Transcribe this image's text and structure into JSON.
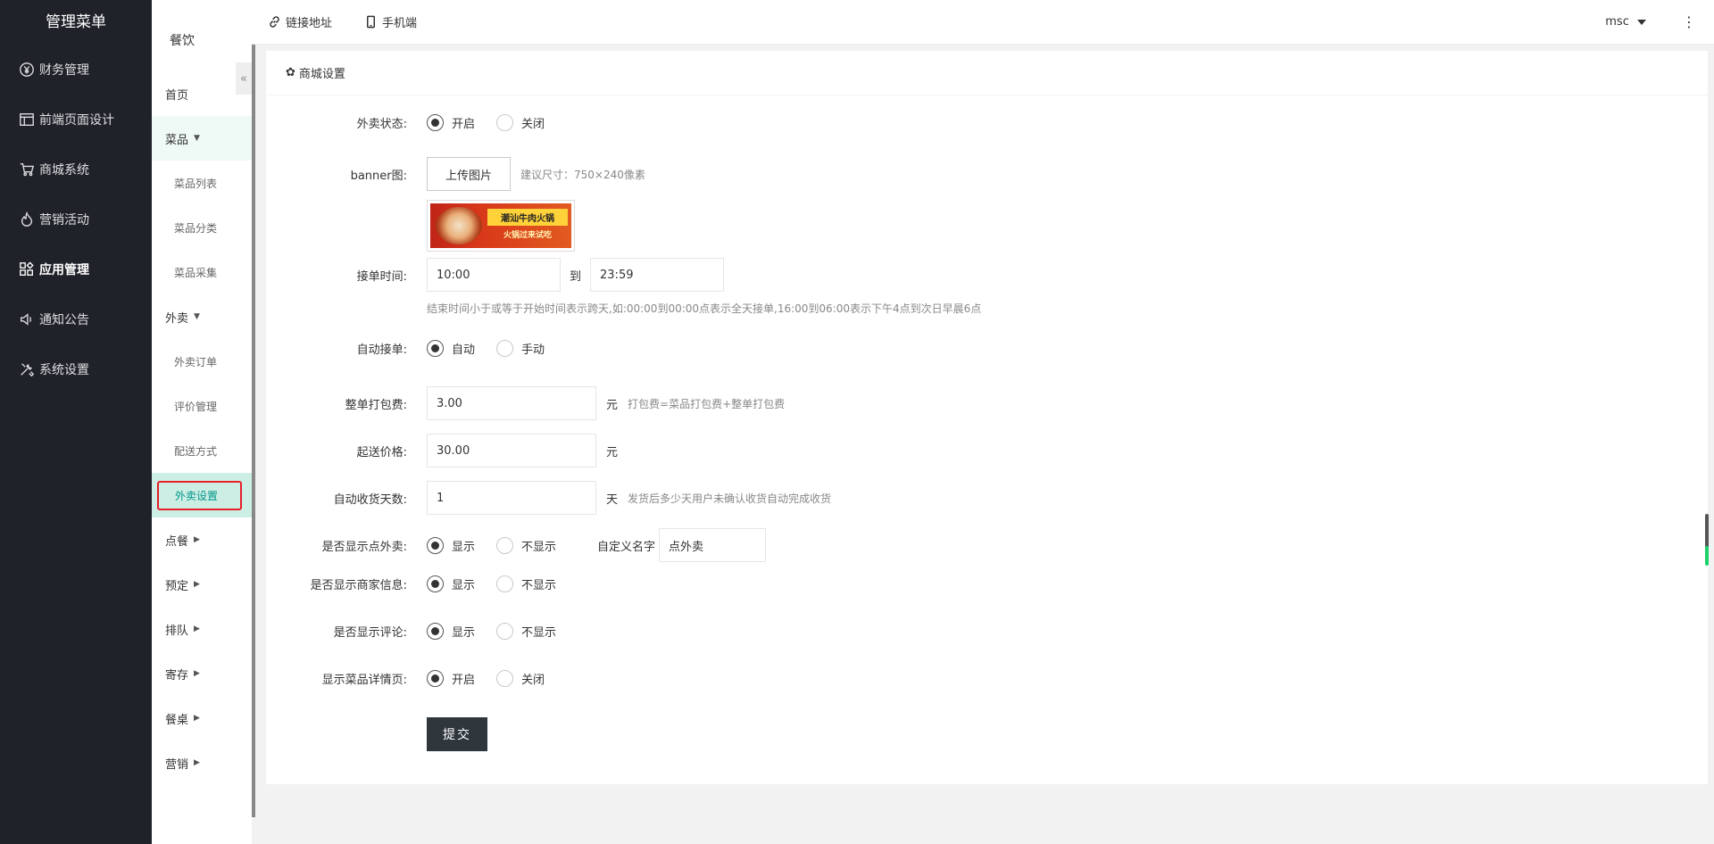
{
  "sidebar": {
    "title": "管理菜单",
    "items": [
      {
        "label": "财务管理",
        "icon": "yen-icon"
      },
      {
        "label": "前端页面设计",
        "icon": "layout-icon"
      },
      {
        "label": "商城系统",
        "icon": "cart-icon"
      },
      {
        "label": "营销活动",
        "icon": "fire-icon"
      },
      {
        "label": "应用管理",
        "icon": "apps-icon",
        "active": true
      },
      {
        "label": "通知公告",
        "icon": "speaker-icon"
      },
      {
        "label": "系统设置",
        "icon": "tools-icon"
      }
    ]
  },
  "subnav": {
    "title": "餐饮",
    "collapse": "«",
    "home": "首页",
    "dishes": {
      "label": "菜品",
      "items": [
        "菜品列表",
        "菜品分类",
        "菜品采集"
      ]
    },
    "takeout": {
      "label": "外卖",
      "items": [
        "外卖订单",
        "评价管理",
        "配送方式",
        "外卖设置"
      ]
    },
    "others": [
      "点餐",
      "预定",
      "排队",
      "寄存",
      "餐桌",
      "营销"
    ]
  },
  "topbar": {
    "link_label": "链接地址",
    "mobile_label": "手机端",
    "user": "msc",
    "more": "⋮"
  },
  "card": {
    "title": "商城设置",
    "fields": {
      "takeout_status": {
        "label": "外卖状态:",
        "options": [
          "开启",
          "关闭"
        ],
        "selected": 0
      },
      "banner": {
        "label": "banner图:",
        "button": "上传图片",
        "hint": "建议尺寸：750×240像素",
        "img_line1": "潮汕牛肉火锅",
        "img_line2": "火锅过来试吃"
      },
      "order_time": {
        "label": "接单时间:",
        "start": "10:00",
        "to": "到",
        "end": "23:59",
        "hint": "结束时间小于或等于开始时间表示跨天,如:00:00到00:00点表示全天接单,16:00到06:00表示下午4点到次日早晨6点"
      },
      "auto_accept": {
        "label": "自动接单:",
        "options": [
          "自动",
          "手动"
        ],
        "selected": 0
      },
      "packing_fee": {
        "label": "整单打包费:",
        "value": "3.00",
        "unit": "元",
        "hint": "打包费=菜品打包费+整单打包费"
      },
      "min_price": {
        "label": "起送价格:",
        "value": "30.00",
        "unit": "元"
      },
      "auto_receive": {
        "label": "自动收货天数:",
        "value": "1",
        "unit": "天",
        "hint": "发货后多少天用户未确认收货自动完成收货"
      },
      "show_takeout": {
        "label": "是否显示点外卖:",
        "options": [
          "显示",
          "不显示"
        ],
        "selected": 0,
        "custom_label": "自定义名字",
        "custom_value": "点外卖"
      },
      "show_merchant": {
        "label": "是否显示商家信息:",
        "options": [
          "显示",
          "不显示"
        ],
        "selected": 0
      },
      "show_comment": {
        "label": "是否显示评论:",
        "options": [
          "显示",
          "不显示"
        ],
        "selected": 0
      },
      "show_detail": {
        "label": "显示菜品详情页:",
        "options": [
          "开启",
          "关闭"
        ],
        "selected": 0
      }
    },
    "submit": "提交"
  }
}
